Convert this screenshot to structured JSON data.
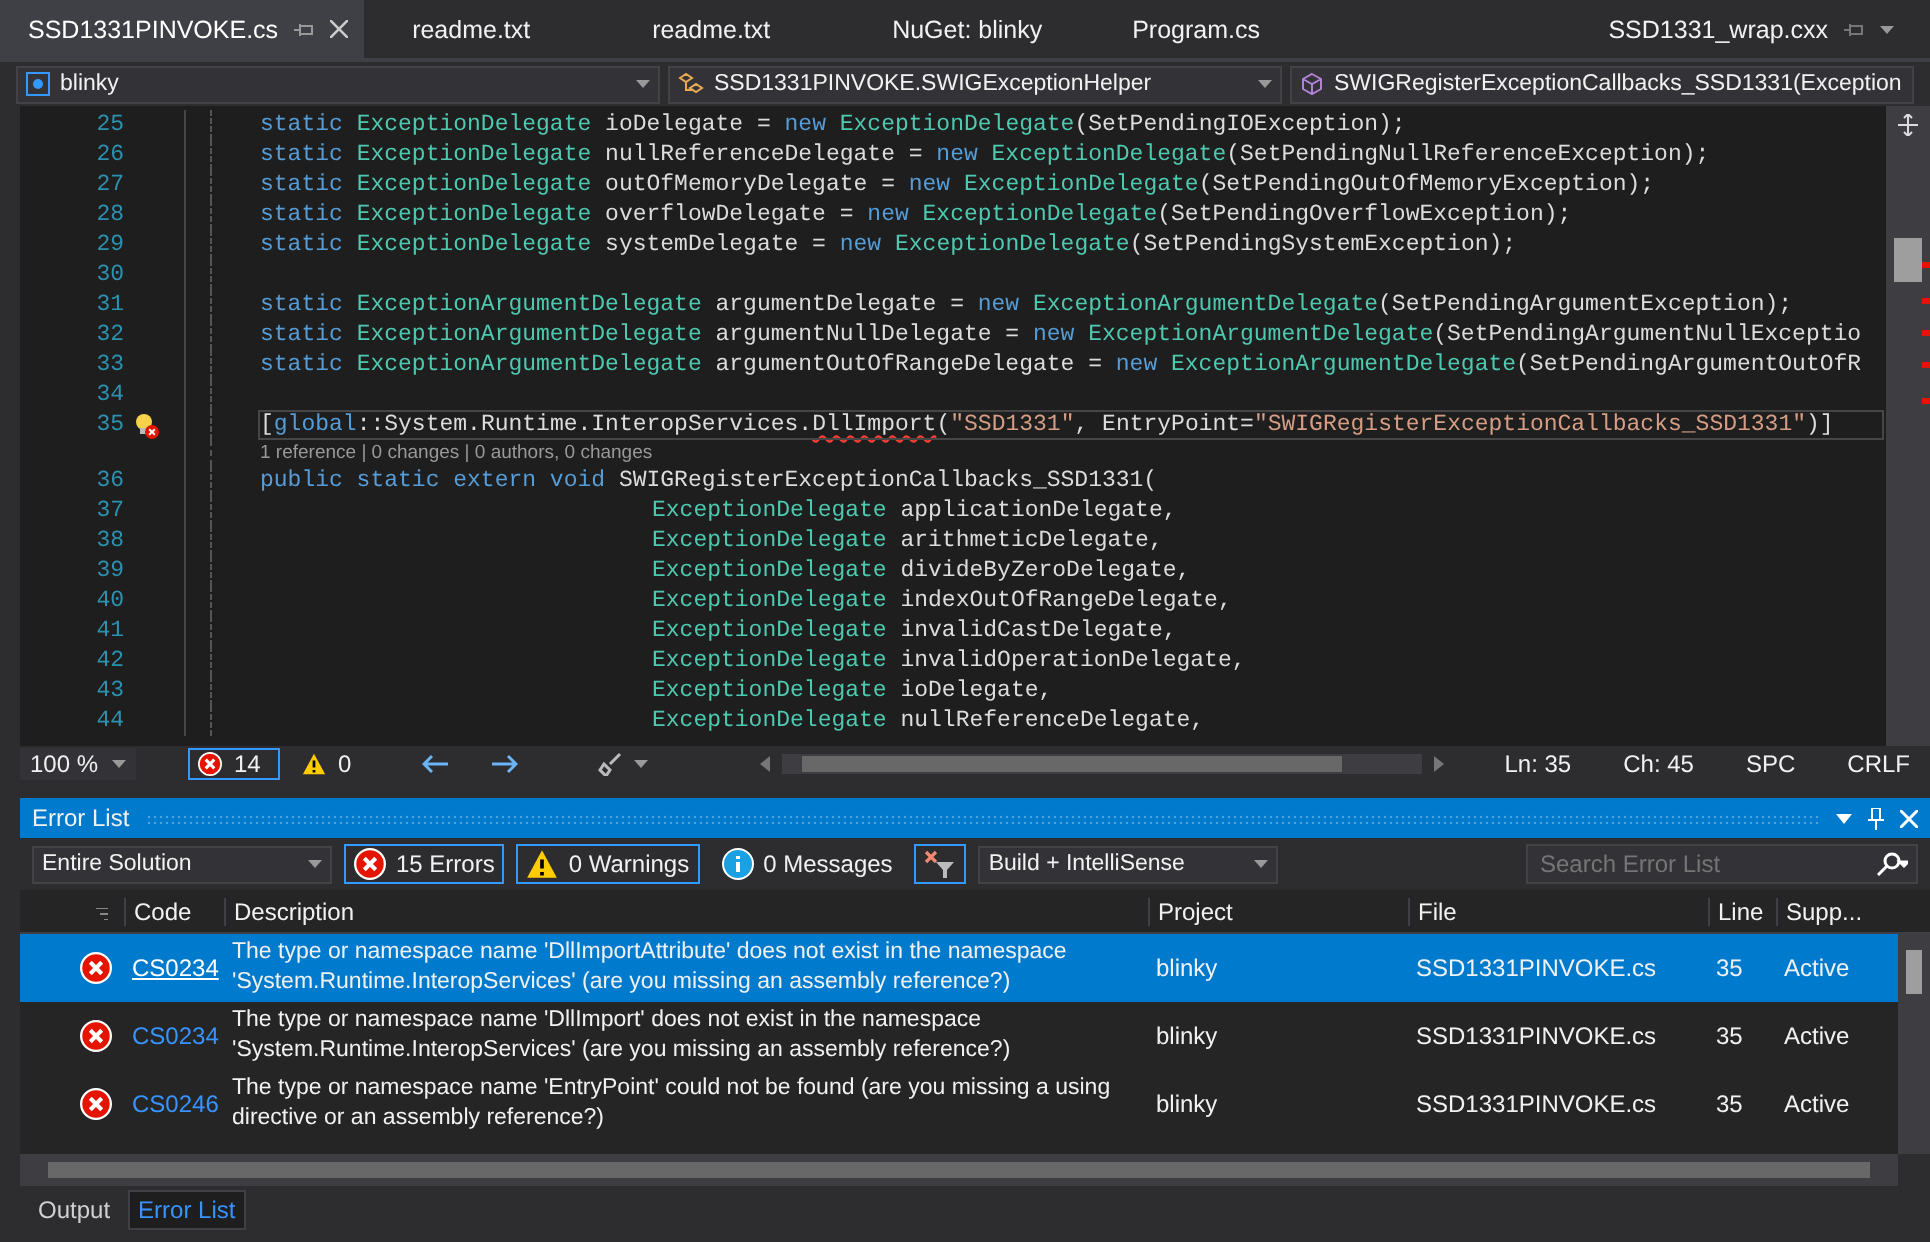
{
  "editor_tabs": [
    {
      "label": "SSD1331PINVOKE.cs",
      "selected": true
    },
    {
      "label": "readme.txt",
      "selected": false
    },
    {
      "label": "readme.txt",
      "selected": false
    },
    {
      "label": "NuGet: blinky",
      "selected": false
    },
    {
      "label": "Program.cs",
      "selected": false
    }
  ],
  "preview_tab": {
    "label": "SSD1331_wrap.cxx"
  },
  "nav_bar": {
    "project": "blinky",
    "type": "SSD1331PINVOKE.SWIGExceptionHelper",
    "member": "SWIGRegisterExceptionCallbacks_SSD1331(Exception"
  },
  "code_lines": [
    {
      "kind": "code",
      "number": "25",
      "tokens": [
        {
          "kind": "kw",
          "text": "static "
        },
        {
          "kind": "type",
          "text": "ExceptionDelegate"
        },
        {
          "kind": "id",
          "text": " ioDelegate = "
        },
        {
          "kind": "kw",
          "text": "new "
        },
        {
          "kind": "type",
          "text": "ExceptionDelegate"
        },
        {
          "kind": "id",
          "text": "(SetPendingIOException);"
        }
      ]
    },
    {
      "kind": "code",
      "number": "26",
      "tokens": [
        {
          "kind": "kw",
          "text": "static "
        },
        {
          "kind": "type",
          "text": "ExceptionDelegate"
        },
        {
          "kind": "id",
          "text": " nullReferenceDelegate = "
        },
        {
          "kind": "kw",
          "text": "new "
        },
        {
          "kind": "type",
          "text": "ExceptionDelegate"
        },
        {
          "kind": "id",
          "text": "(SetPendingNullReferenceException);"
        }
      ]
    },
    {
      "kind": "code",
      "number": "27",
      "tokens": [
        {
          "kind": "kw",
          "text": "static "
        },
        {
          "kind": "type",
          "text": "ExceptionDelegate"
        },
        {
          "kind": "id",
          "text": " outOfMemoryDelegate = "
        },
        {
          "kind": "kw",
          "text": "new "
        },
        {
          "kind": "type",
          "text": "ExceptionDelegate"
        },
        {
          "kind": "id",
          "text": "(SetPendingOutOfMemoryException);"
        }
      ]
    },
    {
      "kind": "code",
      "number": "28",
      "tokens": [
        {
          "kind": "kw",
          "text": "static "
        },
        {
          "kind": "type",
          "text": "ExceptionDelegate"
        },
        {
          "kind": "id",
          "text": " overflowDelegate = "
        },
        {
          "kind": "kw",
          "text": "new "
        },
        {
          "kind": "type",
          "text": "ExceptionDelegate"
        },
        {
          "kind": "id",
          "text": "(SetPendingOverflowException);"
        }
      ]
    },
    {
      "kind": "code",
      "number": "29",
      "tokens": [
        {
          "kind": "kw",
          "text": "static "
        },
        {
          "kind": "type",
          "text": "ExceptionDelegate"
        },
        {
          "kind": "id",
          "text": " systemDelegate = "
        },
        {
          "kind": "kw",
          "text": "new "
        },
        {
          "kind": "type",
          "text": "ExceptionDelegate"
        },
        {
          "kind": "id",
          "text": "(SetPendingSystemException);"
        }
      ]
    },
    {
      "kind": "code",
      "number": "30"
    },
    {
      "kind": "code",
      "number": "31",
      "tokens": [
        {
          "kind": "kw",
          "text": "static "
        },
        {
          "kind": "type",
          "text": "ExceptionArgumentDelegate"
        },
        {
          "kind": "id",
          "text": " argumentDelegate = "
        },
        {
          "kind": "kw",
          "text": "new "
        },
        {
          "kind": "type",
          "text": "ExceptionArgumentDelegate"
        },
        {
          "kind": "id",
          "text": "(SetPendingArgumentException);"
        }
      ]
    },
    {
      "kind": "code",
      "number": "32",
      "tokens": [
        {
          "kind": "kw",
          "text": "static "
        },
        {
          "kind": "type",
          "text": "ExceptionArgumentDelegate"
        },
        {
          "kind": "id",
          "text": " argumentNullDelegate = "
        },
        {
          "kind": "kw",
          "text": "new "
        },
        {
          "kind": "type",
          "text": "ExceptionArgumentDelegate"
        },
        {
          "kind": "id",
          "text": "(SetPendingArgumentNullExceptio"
        }
      ]
    },
    {
      "kind": "code",
      "number": "33",
      "tokens": [
        {
          "kind": "kw",
          "text": "static "
        },
        {
          "kind": "type",
          "text": "ExceptionArgumentDelegate"
        },
        {
          "kind": "id",
          "text": " argumentOutOfRangeDelegate = "
        },
        {
          "kind": "kw",
          "text": "new "
        },
        {
          "kind": "type",
          "text": "ExceptionArgumentDelegate"
        },
        {
          "kind": "id",
          "text": "(SetPendingArgumentOutOfR"
        }
      ]
    },
    {
      "kind": "code",
      "number": "34"
    },
    {
      "kind": "code",
      "number": "35",
      "current": true,
      "error": true,
      "tokens": [
        {
          "kind": "id",
          "text": "["
        },
        {
          "kind": "kw",
          "text": "global"
        },
        {
          "kind": "id",
          "text": "::System.Runtime.InteropServices."
        },
        {
          "kind": "id",
          "text": "DllImport",
          "squiggle": true
        },
        {
          "kind": "id",
          "text": "("
        },
        {
          "kind": "str",
          "text": "\"SSD1331\""
        },
        {
          "kind": "id",
          "text": ", EntryPoint="
        },
        {
          "kind": "str",
          "text": "\"SWIGRegisterExceptionCallbacks_SSD1331\""
        },
        {
          "kind": "id",
          "text": ")]"
        }
      ]
    },
    {
      "kind": "codelens",
      "text": "1 reference | 0 changes | 0 authors, 0 changes"
    },
    {
      "kind": "code",
      "number": "36",
      "tokens": [
        {
          "kind": "kw",
          "text": "public static extern void "
        },
        {
          "kind": "id",
          "text": "SWIGRegisterExceptionCallbacks_SSD1331("
        }
      ]
    },
    {
      "kind": "param",
      "number": "37",
      "tokens": [
        {
          "kind": "type",
          "text": "ExceptionDelegate"
        },
        {
          "kind": "id",
          "text": " applicationDelegate,"
        }
      ]
    },
    {
      "kind": "param",
      "number": "38",
      "tokens": [
        {
          "kind": "type",
          "text": "ExceptionDelegate"
        },
        {
          "kind": "id",
          "text": " arithmeticDelegate,"
        }
      ]
    },
    {
      "kind": "param",
      "number": "39",
      "tokens": [
        {
          "kind": "type",
          "text": "ExceptionDelegate"
        },
        {
          "kind": "id",
          "text": " divideByZeroDelegate,"
        }
      ]
    },
    {
      "kind": "param",
      "number": "40",
      "tokens": [
        {
          "kind": "type",
          "text": "ExceptionDelegate"
        },
        {
          "kind": "id",
          "text": " indexOutOfRangeDelegate,"
        }
      ]
    },
    {
      "kind": "param",
      "number": "41",
      "tokens": [
        {
          "kind": "type",
          "text": "ExceptionDelegate"
        },
        {
          "kind": "id",
          "text": " invalidCastDelegate,"
        }
      ]
    },
    {
      "kind": "param",
      "number": "42",
      "tokens": [
        {
          "kind": "type",
          "text": "ExceptionDelegate"
        },
        {
          "kind": "id",
          "text": " invalidOperationDelegate,"
        }
      ]
    },
    {
      "kind": "param",
      "number": "43",
      "tokens": [
        {
          "kind": "type",
          "text": "ExceptionDelegate"
        },
        {
          "kind": "id",
          "text": " ioDelegate,"
        }
      ]
    },
    {
      "kind": "param",
      "number": "44",
      "tokens": [
        {
          "kind": "type",
          "text": "ExceptionDelegate"
        },
        {
          "kind": "id",
          "text": " nullReferenceDelegate,"
        }
      ]
    }
  ],
  "editor_status": {
    "zoom": "100 %",
    "errors": "14",
    "errors_selected": true,
    "warnings": "0",
    "line": "Ln: 35",
    "column": "Ch: 45",
    "indent": "SPC",
    "line_endings": "CRLF"
  },
  "error_list": {
    "title": "Error List",
    "scope": "Entire Solution",
    "filters": [
      {
        "kind": "error",
        "label": "15 Errors",
        "selected": true
      },
      {
        "kind": "warning",
        "label": "0 Warnings",
        "selected": true
      },
      {
        "kind": "message",
        "label": "0 Messages",
        "selected": false
      }
    ],
    "filter_toggle_selected": true,
    "source": "Build + IntelliSense",
    "search": {
      "placeholder": "Search Error List"
    },
    "columns": [
      "Code",
      "Description",
      "Project",
      "File",
      "Line",
      "Supp..."
    ],
    "rows": [
      {
        "code": "CS0234",
        "description": "The type or namespace name 'DllImportAttribute' does not exist in the namespace 'System.Runtime.InteropServices' (are you missing an assembly reference?)",
        "project": "blinky",
        "file": "SSD1331PINVOKE.cs",
        "line": "35",
        "suppression": "Active",
        "selected": true
      },
      {
        "code": "CS0234",
        "description": "The type or namespace name 'DllImport' does not exist in the namespace 'System.Runtime.InteropServices' (are you missing an assembly reference?)",
        "project": "blinky",
        "file": "SSD1331PINVOKE.cs",
        "line": "35",
        "suppression": "Active",
        "selected": false
      },
      {
        "code": "CS0246",
        "description": "The type or namespace name 'EntryPoint' could not be found (are you missing a using directive or an assembly reference?)",
        "project": "blinky",
        "file": "SSD1331PINVOKE.cs",
        "line": "35",
        "suppression": "Active",
        "selected": false
      }
    ]
  },
  "bottom_tabs": [
    {
      "label": "Output",
      "selected": false
    },
    {
      "label": "Error List",
      "selected": true
    }
  ]
}
